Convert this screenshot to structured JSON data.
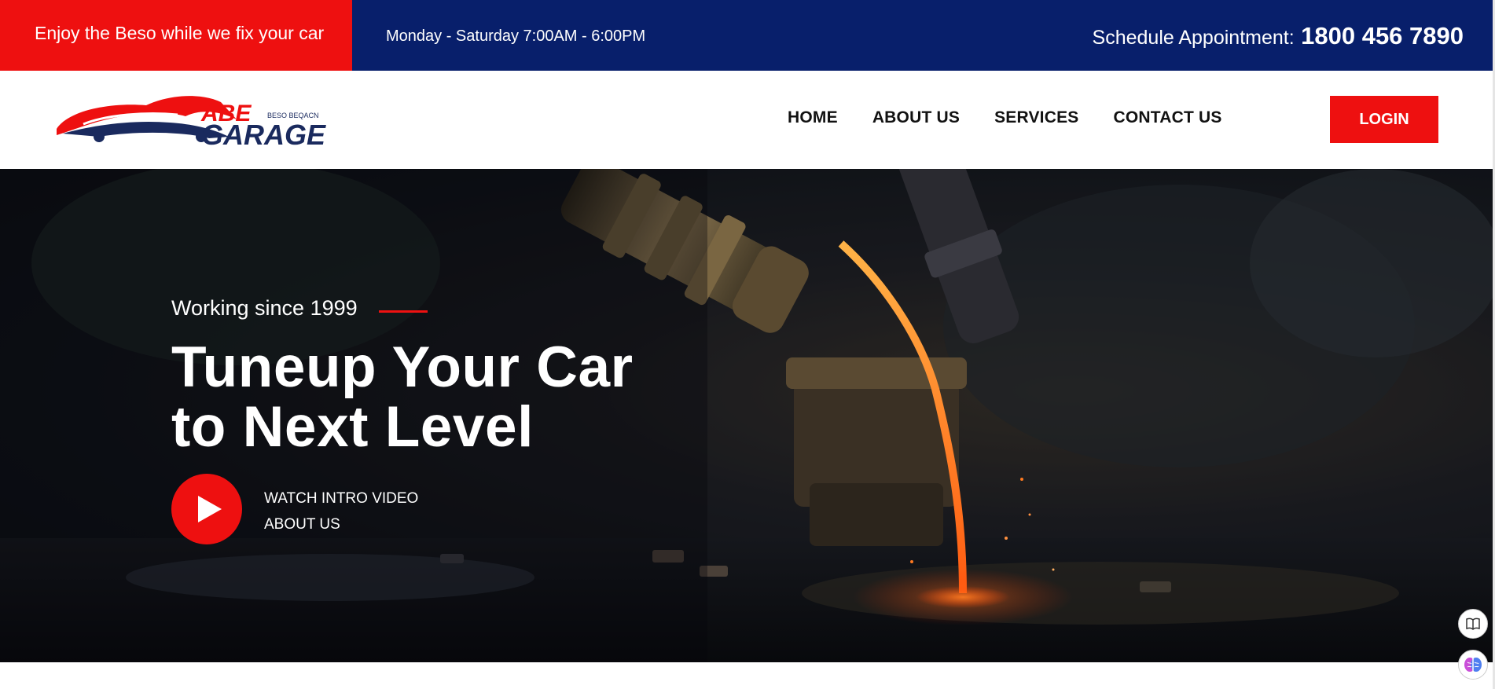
{
  "topbar": {
    "promo": "Enjoy the Beso while we fix your car",
    "hours": "Monday - Saturday 7:00AM - 6:00PM",
    "schedule_label": "Schedule Appointment:",
    "phone": "1800 456 7890"
  },
  "logo": {
    "line1": "ABE",
    "line2": "GARAGE",
    "tagline": "BESO BEQACN"
  },
  "nav": {
    "items": [
      {
        "label": "HOME"
      },
      {
        "label": "ABOUT US"
      },
      {
        "label": "SERVICES"
      },
      {
        "label": "CONTACT US"
      }
    ],
    "login": "LOGIN"
  },
  "hero": {
    "eyebrow": "Working since 1999",
    "title_line1": "Tuneup Your Car",
    "title_line2": "to Next Level",
    "video_line1": "WATCH INTRO VIDEO",
    "video_line2": "ABOUT US"
  },
  "colors": {
    "accent_red": "#ee1010",
    "navy": "#081f6b"
  },
  "icons": {
    "play": "play-icon",
    "book": "book-icon",
    "brain": "brain-icon"
  }
}
